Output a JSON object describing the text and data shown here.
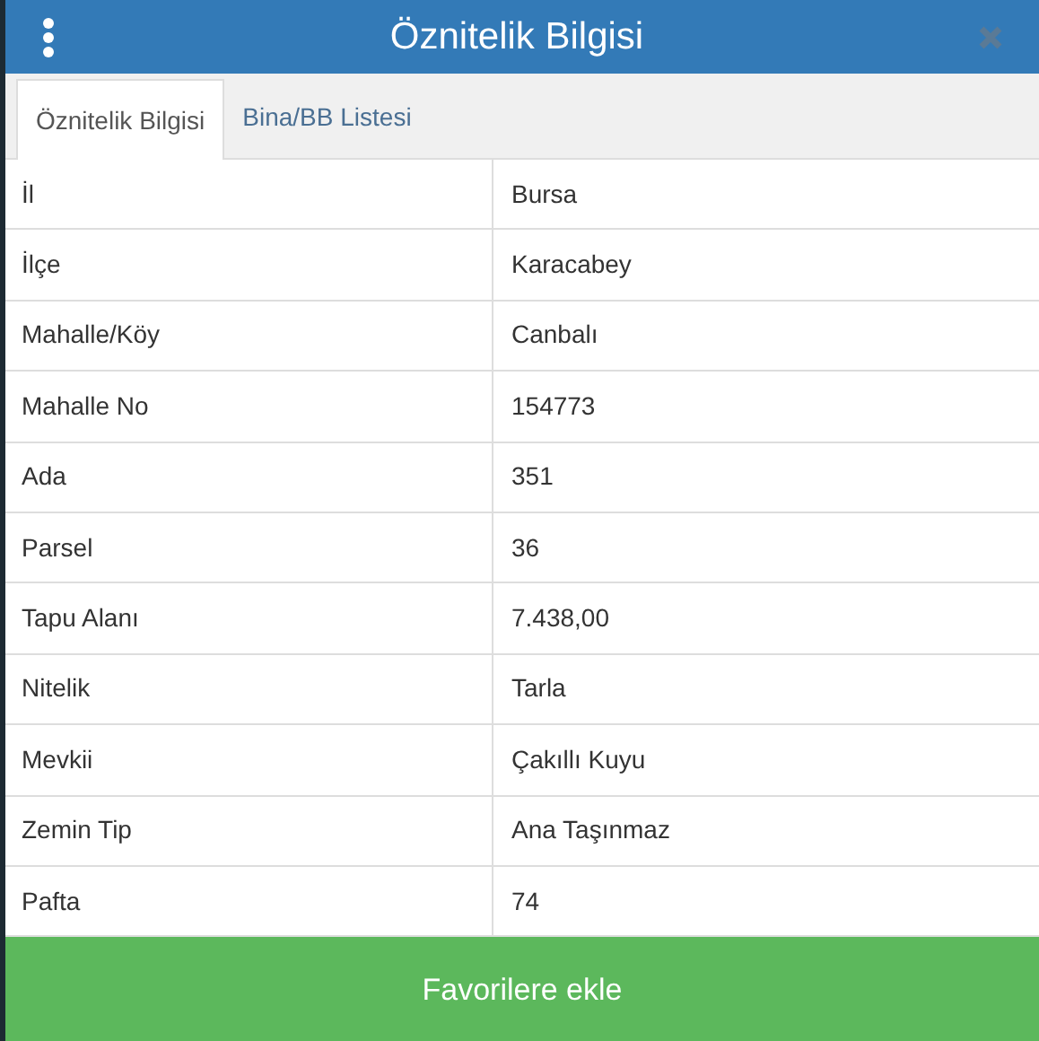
{
  "window": {
    "title": "Öznitelik Bilgisi"
  },
  "tabs": [
    {
      "label": "Öznitelik Bilgisi",
      "selected": true
    },
    {
      "label": "Bina/BB Listesi",
      "selected": false
    }
  ],
  "rows": [
    {
      "label": "İl",
      "value": "Bursa"
    },
    {
      "label": "İlçe",
      "value": "Karacabey"
    },
    {
      "label": "Mahalle/Köy",
      "value": "Canbalı"
    },
    {
      "label": "Mahalle No",
      "value": "154773"
    },
    {
      "label": "Ada",
      "value": "351"
    },
    {
      "label": "Parsel",
      "value": "36"
    },
    {
      "label": "Tapu Alanı",
      "value": "7.438,00"
    },
    {
      "label": "Nitelik",
      "value": "Tarla"
    },
    {
      "label": "Mevkii",
      "value": "Çakıllı Kuyu"
    },
    {
      "label": "Zemin Tip",
      "value": "Ana Taşınmaz"
    },
    {
      "label": "Pafta",
      "value": "74"
    }
  ],
  "footer_button": "Favorilere ekle"
}
